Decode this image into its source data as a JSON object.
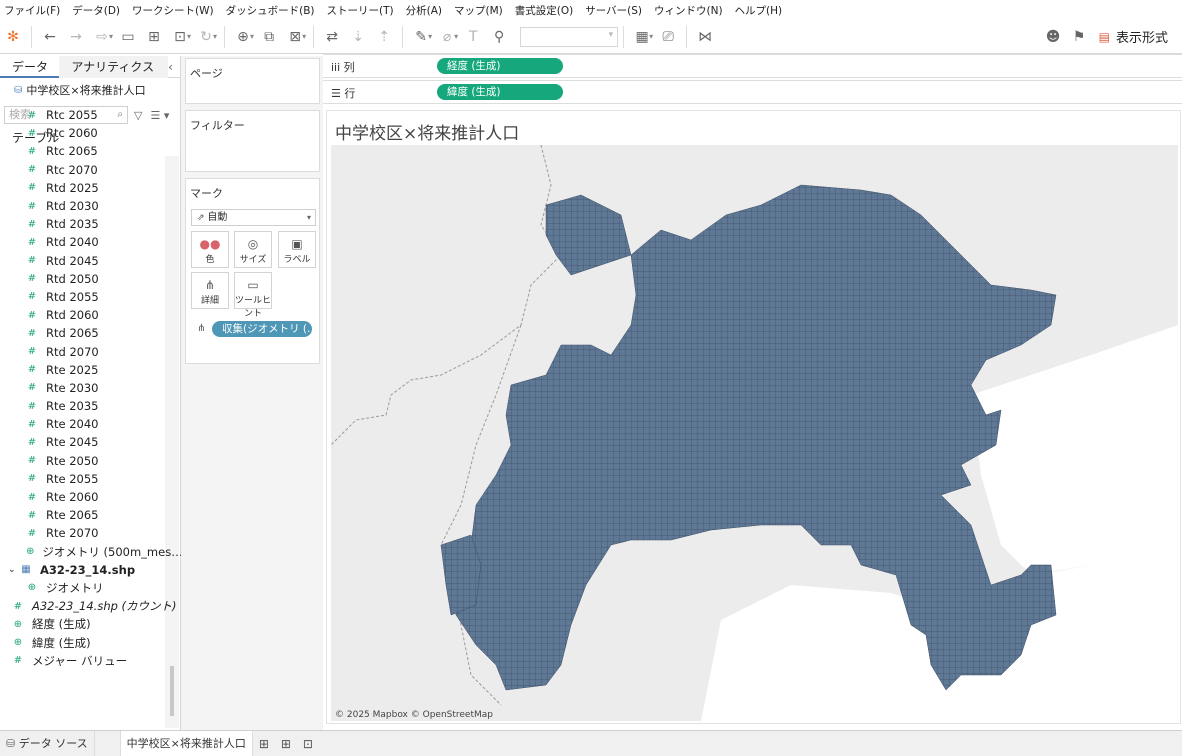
{
  "menu": [
    "ファイル(F)",
    "データ(D)",
    "ワークシート(W)",
    "ダッシュボード(B)",
    "ストーリー(T)",
    "分析(A)",
    "マップ(M)",
    "書式設定(O)",
    "サーバー(S)",
    "ウィンドウ(N)",
    "ヘルプ(H)"
  ],
  "toolbar": {
    "show_me_label": "表示形式"
  },
  "left_pane": {
    "tab_data": "データ",
    "tab_analytics": "アナリティクス",
    "datasource": "中学校区×将来推計人口",
    "search_placeholder": "検索",
    "tables_header": "テーブル",
    "fields": [
      {
        "label": "Rtc 2055",
        "icon": "#",
        "level": 1
      },
      {
        "label": "Rtc 2060",
        "icon": "#",
        "level": 1
      },
      {
        "label": "Rtc 2065",
        "icon": "#",
        "level": 1
      },
      {
        "label": "Rtc 2070",
        "icon": "#",
        "level": 1
      },
      {
        "label": "Rtd 2025",
        "icon": "#",
        "level": 1
      },
      {
        "label": "Rtd 2030",
        "icon": "#",
        "level": 1
      },
      {
        "label": "Rtd 2035",
        "icon": "#",
        "level": 1
      },
      {
        "label": "Rtd 2040",
        "icon": "#",
        "level": 1
      },
      {
        "label": "Rtd 2045",
        "icon": "#",
        "level": 1
      },
      {
        "label": "Rtd 2050",
        "icon": "#",
        "level": 1
      },
      {
        "label": "Rtd 2055",
        "icon": "#",
        "level": 1
      },
      {
        "label": "Rtd 2060",
        "icon": "#",
        "level": 1
      },
      {
        "label": "Rtd 2065",
        "icon": "#",
        "level": 1
      },
      {
        "label": "Rtd 2070",
        "icon": "#",
        "level": 1
      },
      {
        "label": "Rte 2025",
        "icon": "#",
        "level": 1
      },
      {
        "label": "Rte 2030",
        "icon": "#",
        "level": 1
      },
      {
        "label": "Rte 2035",
        "icon": "#",
        "level": 1
      },
      {
        "label": "Rte 2040",
        "icon": "#",
        "level": 1
      },
      {
        "label": "Rte 2045",
        "icon": "#",
        "level": 1
      },
      {
        "label": "Rte 2050",
        "icon": "#",
        "level": 1
      },
      {
        "label": "Rte 2055",
        "icon": "#",
        "level": 1
      },
      {
        "label": "Rte 2060",
        "icon": "#",
        "level": 1
      },
      {
        "label": "Rte 2065",
        "icon": "#",
        "level": 1
      },
      {
        "label": "Rte 2070",
        "icon": "#",
        "level": 1
      },
      {
        "label": "ジオメトリ (500m_mes…",
        "icon": "globe",
        "level": 1
      },
      {
        "label": "A32-23_14.shp",
        "icon": "table",
        "level": 0
      },
      {
        "label": "ジオメトリ",
        "icon": "globe",
        "level": 1
      },
      {
        "label": "A32-23_14.shp (カウント)",
        "icon": "#",
        "level": 2
      },
      {
        "label": "経度 (生成)",
        "icon": "globe",
        "level": 2
      },
      {
        "label": "緯度 (生成)",
        "icon": "globe",
        "level": 2
      },
      {
        "label": "メジャー バリュー",
        "icon": "#",
        "level": 2
      }
    ]
  },
  "cards": {
    "pages_title": "ページ",
    "filters_title": "フィルター",
    "marks_title": "マーク",
    "mark_type": "自動",
    "buttons": [
      "色",
      "サイズ",
      "ラベル",
      "詳細",
      "ツールヒント"
    ],
    "detail_pill": "収集(ジオメトリ (..."
  },
  "shelves": {
    "columns_label": "列",
    "columns_pill": "経度 (生成)",
    "rows_label": "行",
    "rows_pill": "緯度 (生成)"
  },
  "view": {
    "title": "中学校区×将来推計人口",
    "attribution": "© 2025 Mapbox © OpenStreetMap",
    "mesh_color": "#5f7896"
  },
  "statusbar": {
    "datasource_tab": "データ ソース",
    "sheet_tab": "中学校区×将来推計人口"
  }
}
